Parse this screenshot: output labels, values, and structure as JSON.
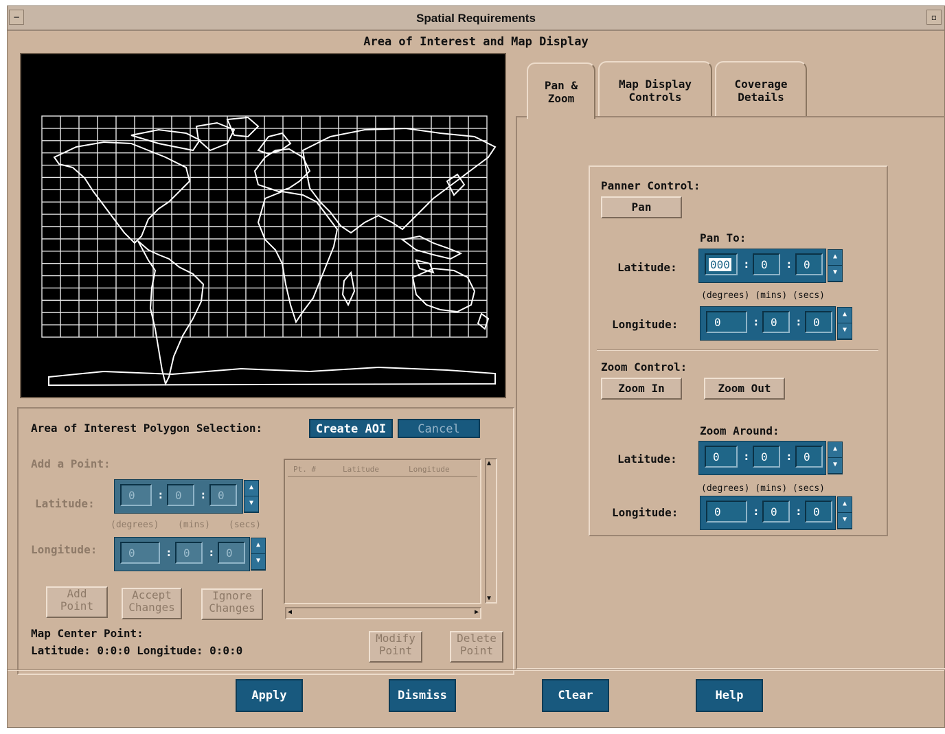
{
  "window": {
    "title": "Spatial Requirements",
    "subtitle": "Area of Interest and Map Display"
  },
  "aoi": {
    "heading": "Area of Interest Polygon Selection:",
    "create_label": "Create AOI",
    "cancel_label": "Cancel",
    "add_point_label": "Add a Point:",
    "latitude_label": "Latitude:",
    "longitude_label": "Longitude:",
    "lat_values": [
      "0",
      "0",
      "0"
    ],
    "lon_values": [
      "0",
      "0",
      "0"
    ],
    "units": {
      "degrees": "(degrees)",
      "mins": "(mins)",
      "secs": "(secs)"
    },
    "add_point_button": "Add Point",
    "accept_button": "Accept Changes",
    "ignore_button": "Ignore Changes",
    "modify_button": "Modify Point",
    "delete_button": "Delete Point",
    "list_columns": [
      "Pt. #",
      "Latitude",
      "Longitude"
    ],
    "map_center_label": "Map Center Point:",
    "map_center_value": "Latitude: 0:0:0 Longitude: 0:0:0"
  },
  "tabs": [
    {
      "label": "Pan & Zoom"
    },
    {
      "label": "Map Display Controls"
    },
    {
      "label": "Coverage Details"
    }
  ],
  "pan_zoom": {
    "panner_label": "Panner Control:",
    "pan_button": "Pan",
    "pan_to_label": "Pan To:",
    "latitude_label": "Latitude:",
    "longitude_label": "Longitude:",
    "pan_lat_values": [
      "000",
      "0",
      "0"
    ],
    "pan_lon_values": [
      "0",
      "0",
      "0"
    ],
    "units_line": "(degrees) (mins) (secs)",
    "zoom_label": "Zoom Control:",
    "zoom_in_button": "Zoom In",
    "zoom_out_button": "Zoom Out",
    "zoom_around_label": "Zoom Around:",
    "zoom_lat_values": [
      "0",
      "0",
      "0"
    ],
    "zoom_lon_values": [
      "0",
      "0",
      "0"
    ]
  },
  "footer": {
    "apply": "Apply",
    "dismiss": "Dismiss",
    "clear": "Clear",
    "help": "Help"
  },
  "colors": {
    "background": "#cdb49d",
    "accent_button": "#18597e",
    "field": "#1f6688",
    "map_bg": "#000000"
  },
  "icons": [
    "minimize-icon",
    "maximize-icon",
    "spin-up-icon",
    "spin-down-icon",
    "scroll-up-icon",
    "scroll-down-icon",
    "scroll-left-icon",
    "scroll-right-icon"
  ]
}
